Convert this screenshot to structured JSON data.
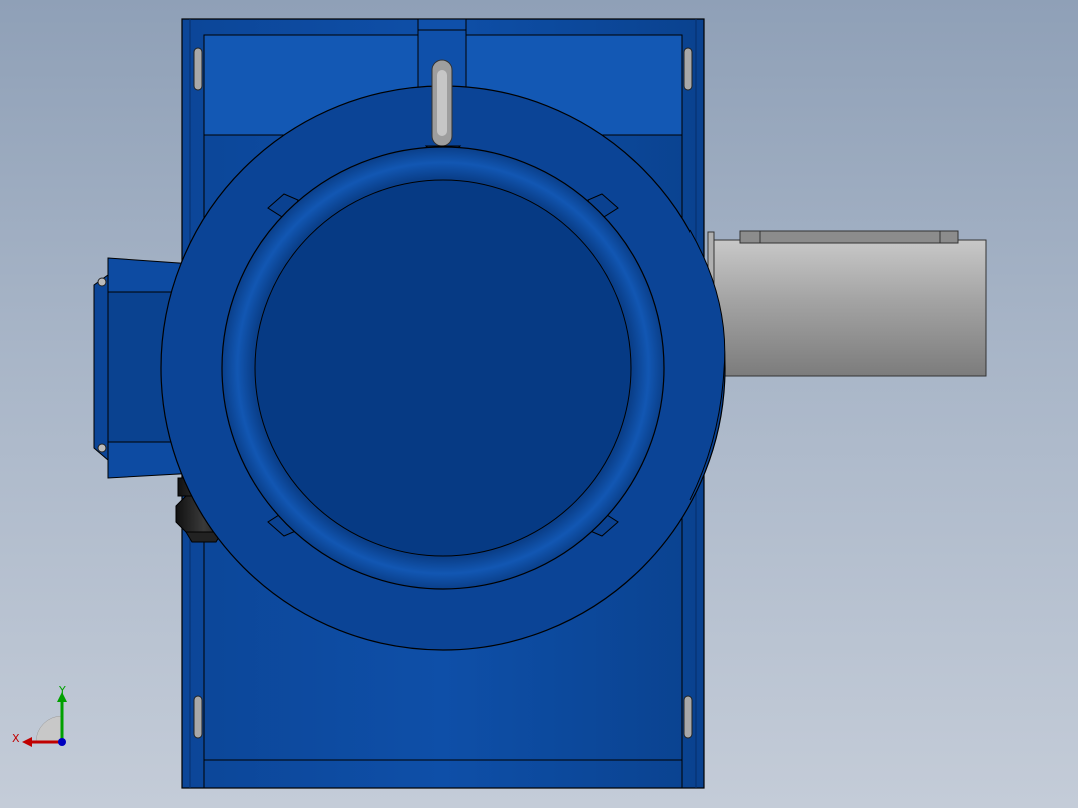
{
  "scene": {
    "background_top": "#8fa0b7",
    "background_bottom": "#c4ccd8",
    "body_color": "#0d4aa0",
    "body_dark": "#083a80",
    "shaft_color": "#9a9a9a",
    "gland_color": "#1a1a1a"
  },
  "triad": {
    "x_label": "X",
    "y_label": "Y",
    "x_color": "#c00000",
    "y_color": "#00a000",
    "z_color": "#0000c0"
  }
}
